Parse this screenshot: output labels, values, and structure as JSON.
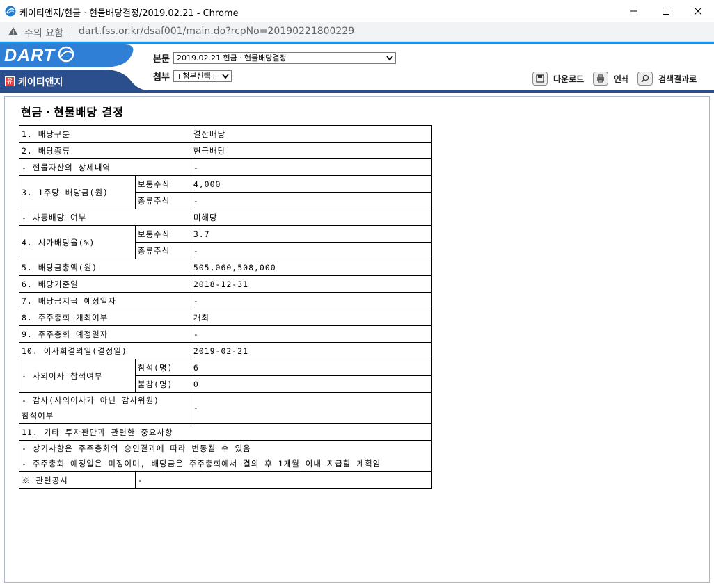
{
  "browser": {
    "window_title": "케이티앤지/현금ㆍ현물배당결정/2019.02.21 - Chrome",
    "security_warning": "주의 요함",
    "url": "dart.fss.or.kr/dsaf001/main.do?rcpNo=20190221800229"
  },
  "header": {
    "logo": "DART",
    "company_badge": "유",
    "company_name": "케이티앤지",
    "main_label": "본문",
    "main_select_value": "2019.02.21  현금ㆍ현물배당결정",
    "attach_label": "첨부",
    "attach_select_value": "+첨부선택+",
    "download_label": "다운로드",
    "print_label": "인쇄",
    "search_result_label": "검색결과로",
    "accent_color": "#1f8fe0",
    "nav_color": "#2b4f8c"
  },
  "document": {
    "title": "현금ㆍ현물배당 결정",
    "rows": {
      "div_type_label": "1. 배당구분",
      "div_type_value": "결산배당",
      "div_kind_label": "2. 배당종류",
      "div_kind_value": "현금배당",
      "inkind_detail_label": "- 현물자산의 상세내역",
      "inkind_detail_value": "-",
      "dps_label": "3. 1주당 배당금(원)",
      "dps_common_label": "보통주식",
      "dps_common_value": "4,000",
      "dps_pref_label": "종류주식",
      "dps_pref_value": "-",
      "diff_div_label": "- 차등배당 여부",
      "diff_div_value": "미해당",
      "yield_label": "4. 시가배당율(%)",
      "yield_common_label": "보통주식",
      "yield_common_value": "3.7",
      "yield_pref_label": "종류주식",
      "yield_pref_value": "-",
      "total_label": "5. 배당금총액(원)",
      "total_value": "505,060,508,000",
      "record_date_label": "6. 배당기준일",
      "record_date_value": "2018-12-31",
      "pay_date_label": "7. 배당금지급 예정일자",
      "pay_date_value": "-",
      "agm_held_label": "8. 주주총회 개최여부",
      "agm_held_value": "개최",
      "agm_date_label": "9. 주주총회 예정일자",
      "agm_date_value": "-",
      "board_date_label": "10. 이사회결의일(결정일)",
      "board_date_value": "2019-02-21",
      "outside_dir_label": "- 사외이사 참석여부",
      "present_label": "참석(명)",
      "present_value": "6",
      "absent_label": "불참(명)",
      "absent_value": "0",
      "auditor_label_1": "- 감사(사외이사가 아닌 감사위원)",
      "auditor_label_2": "참석여부",
      "auditor_value": "-",
      "other_label": "11. 기타 투자판단과 관련한 중요사항",
      "other_note_1": "- 상기사항은 주주총회의 승인결과에 따라 변동될 수 있음",
      "other_note_2": "- 주주총회 예정일은 미정이며, 배당금은 주주총회에서 결의 후 1개월 이내 지급할 계획임",
      "related_label": "※ 관련공시",
      "related_value": "-"
    }
  }
}
